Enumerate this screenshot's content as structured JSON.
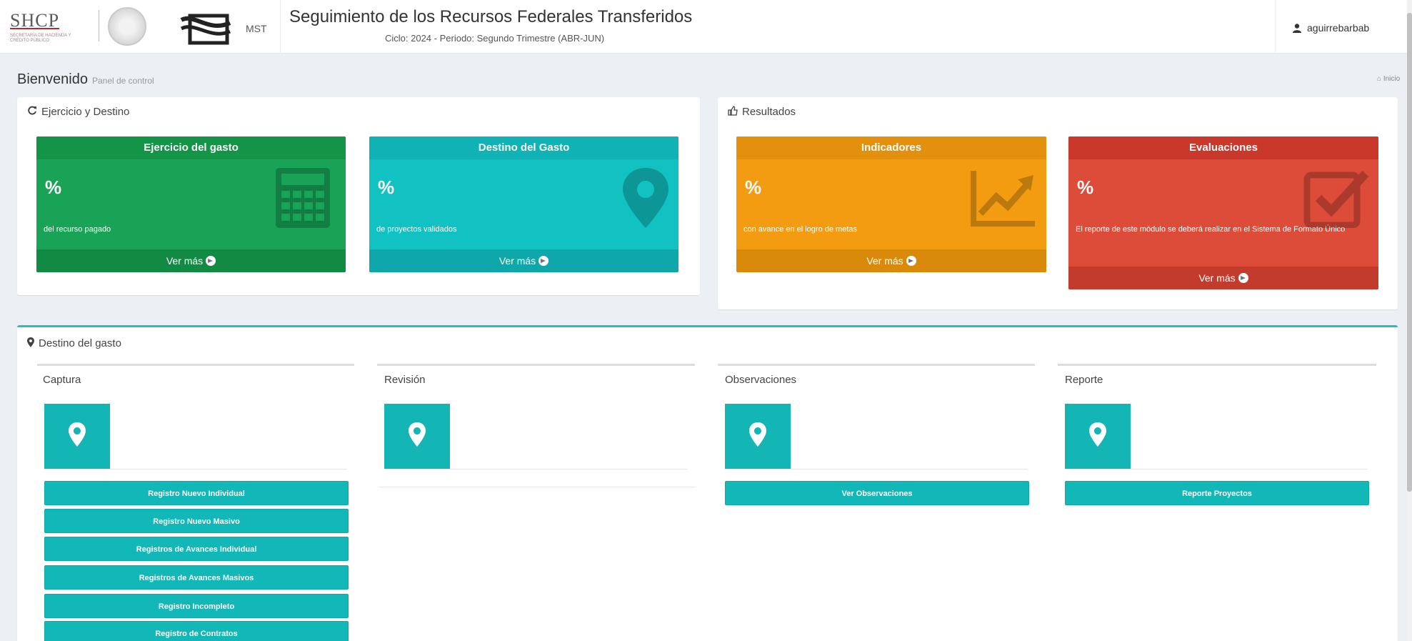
{
  "header": {
    "shcp_logo": "SHCP",
    "shcp_sub": "SECRETARÍA DE HACIENDA Y CRÉDITO PÚBLICO",
    "mst_label": "MST",
    "title": "Seguimiento de los Recursos Federales Transferidos",
    "cycle": "Ciclo: 2024 - Periodo: Segundo Trimestre (ABR-JUN)",
    "user": "aguirrebarbab"
  },
  "page": {
    "title": "Bienvenido",
    "subtitle": "Panel de control",
    "crumb": "Inicio"
  },
  "ejercicio": {
    "title": "Ejercicio y Destino",
    "cards": [
      {
        "title": "Ejercicio del gasto",
        "value": "%",
        "desc": "del recurso pagado",
        "more": "Ver más",
        "icon": "calculator-icon",
        "color": "#19a356"
      },
      {
        "title": "Destino del Gasto",
        "value": "%",
        "desc": "de proyectos validados",
        "more": "Ver más",
        "icon": "map-marker-icon",
        "color": "#12c1c1"
      }
    ]
  },
  "resultados": {
    "title": "Resultados",
    "cards": [
      {
        "title": "Indicadores",
        "value": "%",
        "desc": "con avance en el logro de metas",
        "more": "Ver más",
        "icon": "line-chart-icon",
        "color": "#f39c12"
      },
      {
        "title": "Evaluaciones",
        "value": "%",
        "desc": "El reporte de este módulo se deberá realizar en el Sistema de Formato Único",
        "more": "Ver más",
        "icon": "check-square-icon",
        "color": "#dd4b39"
      }
    ]
  },
  "destino": {
    "title": "Destino del gasto",
    "columns": [
      {
        "title": "Captura",
        "buttons": [
          "Registro Nuevo Individual",
          "Registro Nuevo Masivo",
          "Registros de Avances Individual",
          "Registros de Avances Masivos",
          "Registro Incompleto",
          "Registro de Contratos"
        ]
      },
      {
        "title": "Revisión",
        "buttons": []
      },
      {
        "title": "Observaciones",
        "buttons": [
          "Ver Observaciones"
        ]
      },
      {
        "title": "Reporte",
        "buttons": [
          "Reporte Proyectos"
        ]
      }
    ]
  }
}
